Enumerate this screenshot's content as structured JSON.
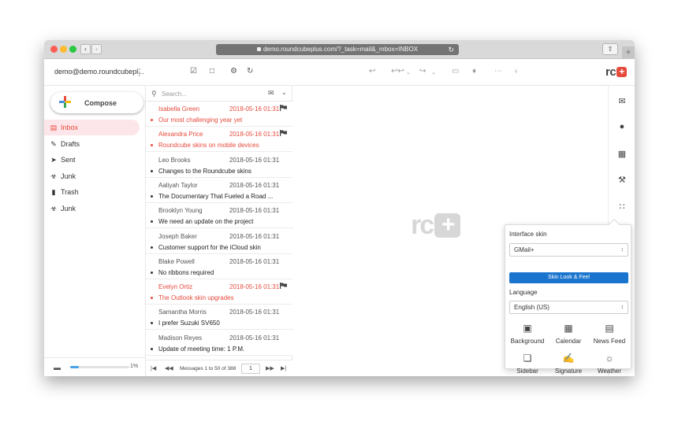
{
  "browser": {
    "url": "demo.roundcubeplus.com/?_task=mail&_mbox=INBOX",
    "back_icon": "chevron-left-icon",
    "forward_icon": "chevron-right-icon",
    "new_tab_label": "+"
  },
  "header": {
    "account": "demo@demo.roundcubepl...",
    "logo_text": "rc",
    "logo_plus": "+",
    "icons": [
      "checkbox-icon",
      "comment-icon",
      "gear-icon",
      "refresh-icon",
      "reply-icon",
      "reply-all-icon",
      "forward-icon",
      "trash-icon",
      "tag-icon",
      "more-icon",
      "back-icon"
    ]
  },
  "sidebar": {
    "compose_label": "Compose",
    "folders": [
      {
        "label": "Inbox",
        "icon": "inbox-icon",
        "active": true
      },
      {
        "label": "Drafts",
        "icon": "pencil-icon",
        "active": false
      },
      {
        "label": "Sent",
        "icon": "send-icon",
        "active": false
      },
      {
        "label": "Junk",
        "icon": "junk-icon",
        "active": false
      },
      {
        "label": "Trash",
        "icon": "trash-icon",
        "active": false
      },
      {
        "label": "Junk",
        "icon": "junk-icon",
        "active": false
      }
    ],
    "quota_percent": "1%",
    "quota_fraction": 0.15
  },
  "messages": {
    "search_placeholder": "Search...",
    "items": [
      {
        "from": "Isabella Green",
        "date": "2018-05-16 01:31",
        "subject": "Our most challenging year yet",
        "flagged": true
      },
      {
        "from": "Alexandra Price",
        "date": "2018-05-16 01:31",
        "subject": "Roundcube skins on mobile devices",
        "flagged": true
      },
      {
        "from": "Leo Brooks",
        "date": "2018-05-16 01:31",
        "subject": "Changes to the Roundcube skins",
        "flagged": false
      },
      {
        "from": "Aaliyah Taylor",
        "date": "2018-05-16 01:31",
        "subject": "The Documentary That Fueled a Road ...",
        "flagged": false
      },
      {
        "from": "Brooklyn Young",
        "date": "2018-05-16 01:31",
        "subject": "We need an update on the project",
        "flagged": false
      },
      {
        "from": "Joseph Baker",
        "date": "2018-05-16 01:31",
        "subject": "Customer support for the iCloud skin",
        "flagged": false
      },
      {
        "from": "Blake Powell",
        "date": "2018-05-16 01:31",
        "subject": "No ribbons required",
        "flagged": false
      },
      {
        "from": "Evelyn Ortiz",
        "date": "2018-05-16 01:31",
        "subject": "The Outlook skin upgrades",
        "flagged": true
      },
      {
        "from": "Samantha Morris",
        "date": "2018-05-16 01:31",
        "subject": "I prefer Suzuki SV650",
        "flagged": false
      },
      {
        "from": "Madison Reyes",
        "date": "2018-05-16 01:31",
        "subject": "Update of meeting time: 1 P.M.",
        "flagged": false
      }
    ],
    "pager_text": "Messages 1 to 50 of 388",
    "page_number": "1"
  },
  "content": {
    "watermark_text": "rc",
    "watermark_plus": "+"
  },
  "rightbar": {
    "icons": [
      "mail-icon",
      "contacts-icon",
      "calendar-icon",
      "wrench-icon",
      "apps-grid-icon"
    ]
  },
  "popover": {
    "interface_skin_label": "Interface skin",
    "skin_value": "GMail+",
    "look_feel_button": "Skin Look & Feel",
    "language_label": "Language",
    "language_value": "English (US)",
    "options": [
      {
        "label": "Background",
        "icon": "image-icon"
      },
      {
        "label": "Calendar",
        "icon": "calendar-icon"
      },
      {
        "label": "News Feed",
        "icon": "newspaper-icon"
      },
      {
        "label": "Sidebar",
        "icon": "sidebar-icon"
      },
      {
        "label": "Signature",
        "icon": "signature-pen-icon"
      },
      {
        "label": "Weather",
        "icon": "sun-icon"
      }
    ]
  },
  "colors": {
    "accent": "#e64a3c",
    "active_bg": "#fde6e9",
    "button_blue": "#1b75cf"
  }
}
